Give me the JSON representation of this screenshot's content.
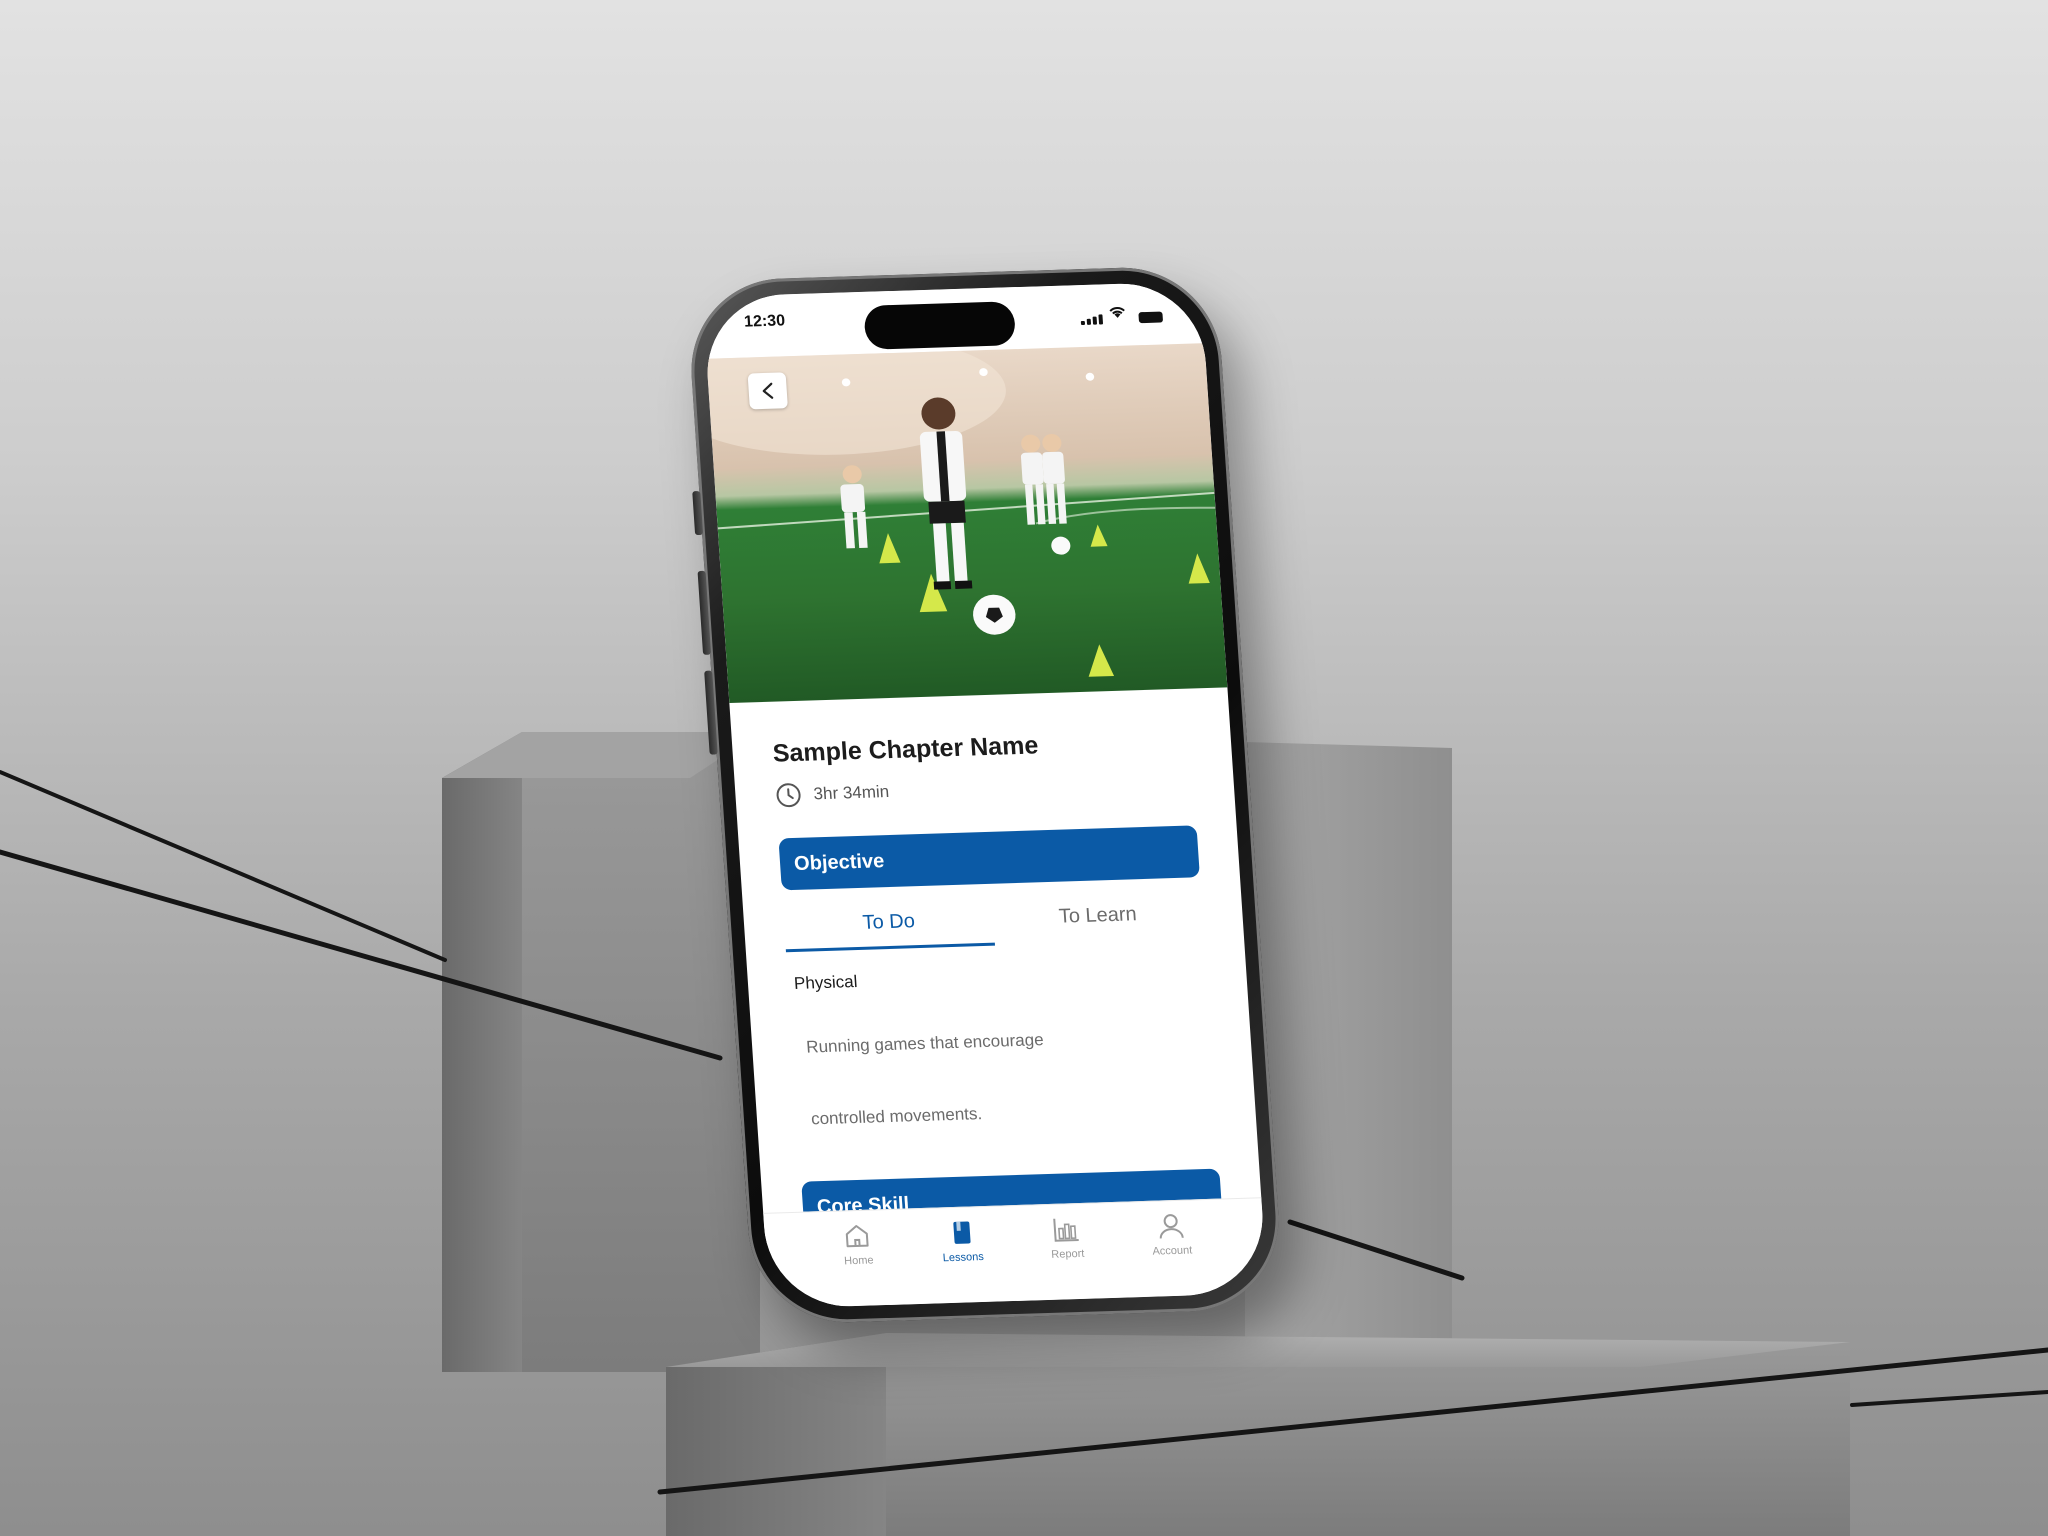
{
  "status_bar": {
    "time": "12:30"
  },
  "hero": {
    "image_description_icon": "soccer-training-photo",
    "back_icon": "chevron-left-icon"
  },
  "chapter": {
    "title": "Sample Chapter Name",
    "duration": "3hr 34min",
    "duration_icon": "clock-icon"
  },
  "sections": {
    "objective_label": "Objective",
    "core_skill_label": "Core Skill"
  },
  "tabs": [
    {
      "label": "To Do",
      "active": true
    },
    {
      "label": "To Learn",
      "active": false
    }
  ],
  "physical": {
    "label": "Physical",
    "line1": "Running games that encourage",
    "line2": "controlled movements."
  },
  "bottom_nav": [
    {
      "label": "Home",
      "icon": "home-icon",
      "active": false
    },
    {
      "label": "Lessons",
      "icon": "book-icon",
      "active": true
    },
    {
      "label": "Report",
      "icon": "bar-chart-icon",
      "active": false
    },
    {
      "label": "Account",
      "icon": "user-icon",
      "active": false
    }
  ],
  "colors": {
    "accent": "#0b5aa6",
    "text_dark": "#1c1c1c",
    "text_muted": "#6b6b6b"
  }
}
